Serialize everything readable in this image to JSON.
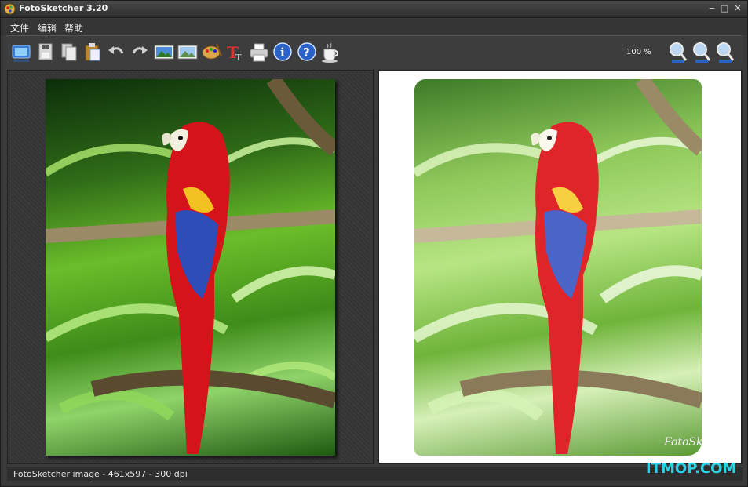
{
  "window": {
    "title": "FotoSketcher 3.20",
    "controls": {
      "minimize": "‒",
      "maximize": "□",
      "close": "✕"
    }
  },
  "menu": {
    "items": [
      {
        "label": "文件"
      },
      {
        "label": "编辑"
      },
      {
        "label": "帮助"
      }
    ]
  },
  "toolbar": {
    "zoom_level": "100 %",
    "buttons": [
      {
        "name": "open-icon"
      },
      {
        "name": "save-icon"
      },
      {
        "name": "copy-icon"
      },
      {
        "name": "paste-icon"
      },
      {
        "name": "undo-icon"
      },
      {
        "name": "redo-icon"
      },
      {
        "name": "original-image-icon"
      },
      {
        "name": "processed-image-icon"
      },
      {
        "name": "palette-icon"
      },
      {
        "name": "text-icon"
      },
      {
        "name": "print-icon"
      },
      {
        "name": "info-icon"
      },
      {
        "name": "help-icon"
      },
      {
        "name": "coffee-icon"
      },
      {
        "name": "zoom-in-icon"
      },
      {
        "name": "zoom-actual-icon"
      },
      {
        "name": "zoom-out-icon"
      }
    ]
  },
  "images": {
    "left": {
      "description": "original-photo"
    },
    "right": {
      "description": "processed-photo",
      "signature": "FotoSketcher"
    }
  },
  "status": {
    "text": "FotoSketcher image - 461x597 - 300 dpi"
  },
  "watermark": {
    "text": "ITMOP.COM"
  },
  "colors": {
    "window_bg": "#3a3a3a",
    "titlebar": "#2e2e2e",
    "watermark": "#2ad2e6",
    "parrot_red": "#d4141a",
    "parrot_blue": "#2f4db8"
  }
}
